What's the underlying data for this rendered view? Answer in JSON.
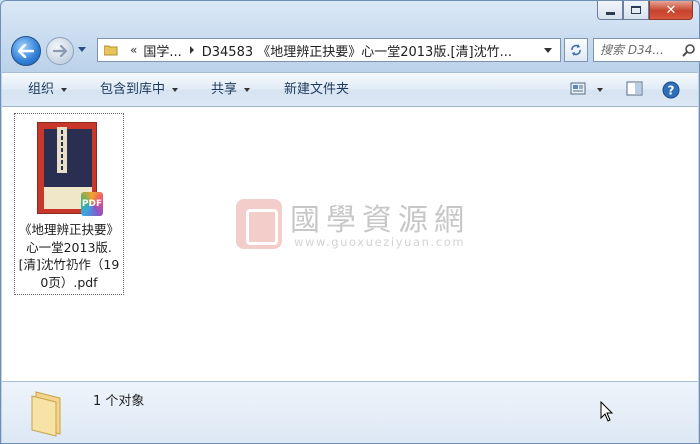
{
  "window": {
    "caption_buttons": {
      "minimize": "minimize",
      "maximize": "maximize",
      "close": "close"
    }
  },
  "nav": {
    "address": {
      "overflow_chevron": "«",
      "crumb1": "国学...",
      "crumb2": "D34583 《地理辨正抉要》心一堂2013版.[清]沈竹..."
    },
    "search_placeholder": "搜索 D34..."
  },
  "toolbar": {
    "organize": "组织",
    "include_in_library": "包含到库中",
    "share": "共享",
    "new_folder": "新建文件夹"
  },
  "files": [
    {
      "name": "《地理辨正抉要》心一堂2013版.[清]沈竹礽作（190页）.pdf",
      "type_badge": "PDF"
    }
  ],
  "watermark": {
    "title": "國學資源網",
    "url": "www.guoxueziyuan.com"
  },
  "details": {
    "count_text": "1 个对象"
  },
  "colors": {
    "accent": "#1e395b",
    "window_frame": "#bcd2ea"
  }
}
